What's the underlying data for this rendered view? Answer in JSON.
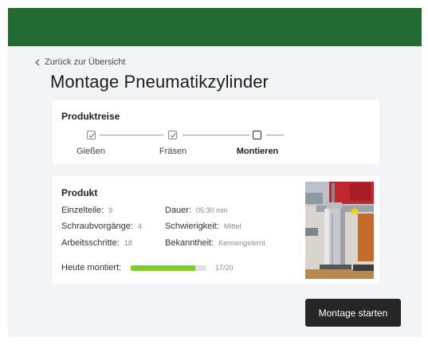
{
  "header": {
    "brand_color": "#236a30"
  },
  "nav": {
    "back_label": "Zurück zur Übersicht",
    "back_icon": "chevron-left-icon"
  },
  "page": {
    "title": "Montage Pneumatikzylinder"
  },
  "journey": {
    "title": "Produktreise",
    "steps": [
      {
        "label": "Gießen",
        "state": "done",
        "icon": "checkbox-checked-icon"
      },
      {
        "label": "Fräsen",
        "state": "done",
        "icon": "checkbox-checked-icon"
      },
      {
        "label": "Montieren",
        "state": "current",
        "icon": "checkbox-empty-icon"
      }
    ]
  },
  "product": {
    "title": "Produkt",
    "left": [
      {
        "label": "Einzelteile:",
        "value": "9"
      },
      {
        "label": "Schraubvorgänge:",
        "value": "4"
      },
      {
        "label": "Arbeitsschritte:",
        "value": "18"
      }
    ],
    "right": [
      {
        "label": "Dauer:",
        "value": "05:30 min"
      },
      {
        "label": "Schwierigkeit:",
        "value": "Mittel"
      },
      {
        "label": "Bekanntheit:",
        "value": "Kennengelernt"
      }
    ],
    "progress": {
      "label": "Heute montiert:",
      "done": 17,
      "total": 20,
      "text": "17/20",
      "color": "#7ccf2a"
    },
    "image": "pneumatic-cylinder-photo"
  },
  "actions": {
    "start_label": "Montage starten"
  }
}
